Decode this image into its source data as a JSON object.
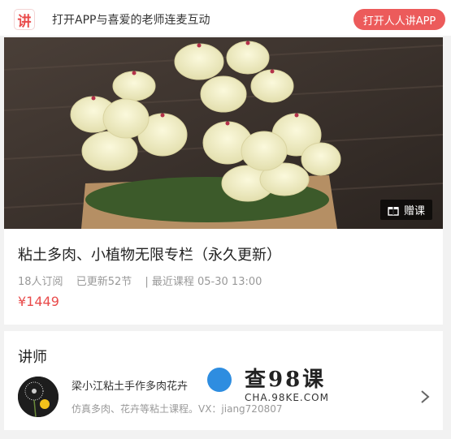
{
  "header": {
    "logo_glyph": "讲",
    "promo_text": "打开APP与喜爱的老师连麦互动",
    "open_app_label": "打开人人讲APP"
  },
  "hero": {
    "gift_label": "赠课"
  },
  "course": {
    "title": "粘土多肉、小植物无限专栏（永久更新）",
    "subscribers": "18人订阅",
    "updated": "已更新52节",
    "latest": "| 最近课程 05-30 13:00",
    "price": "¥1449"
  },
  "lecturer": {
    "heading": "讲师",
    "name": "梁小江粘土手作多肉花卉",
    "description": "仿真多肉、花卉等粘土课程。VX：jiang720807"
  },
  "watermark": {
    "text": "查98课",
    "url": "CHA.98KE.COM"
  },
  "colors": {
    "accent": "#ec5b5b",
    "price": "#e94b4b"
  }
}
